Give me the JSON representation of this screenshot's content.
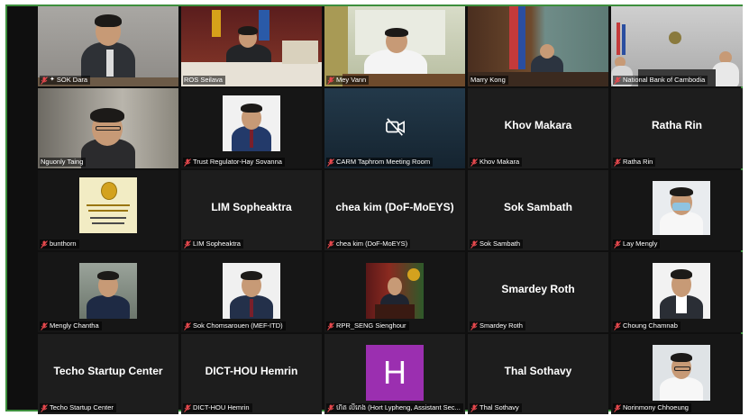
{
  "participants": [
    {
      "name": "SOK Dara",
      "pinned": true
    },
    {
      "name": "ROS Seilava"
    },
    {
      "name": "Mey Vann"
    },
    {
      "name": "Marry Kong",
      "active": true
    },
    {
      "name": "National Bank of Cambodia"
    },
    {
      "name": "Nguonly Taing"
    },
    {
      "name": "Trust Regulator-Hay Sovanna"
    },
    {
      "name": "CARM Taphrom Meeting Room"
    },
    {
      "name": "Khov Makara",
      "display": "Khov Makara"
    },
    {
      "name": "Ratha Rin",
      "display": "Ratha Rin"
    },
    {
      "name": "bunthorn"
    },
    {
      "name": "LIM Sopheaktra",
      "display": "LIM Sopheaktra"
    },
    {
      "name": "chea kim (DoF-MoEYS)",
      "display": "chea kim (DoF-MoEYS)"
    },
    {
      "name": "Sok Sambath",
      "display": "Sok Sambath"
    },
    {
      "name": "Lay Mengly"
    },
    {
      "name": "Mengly Chantha"
    },
    {
      "name": "Sok Chomsarouen (MEF-ITD)"
    },
    {
      "name": "RPR_SENG Sienghour"
    },
    {
      "name": "Smardey Roth",
      "display": "Smardey Roth"
    },
    {
      "name": "Choung Chamnab"
    },
    {
      "name": "Techo Startup Center",
      "display": "Techo Startup Center"
    },
    {
      "name": "DICT-HOU Hemrin",
      "display": "DICT-HOU Hemrin"
    },
    {
      "name": "ហ៊ត លីភេង (Hort Lypheng, Assistant Sec...",
      "avatar_letter": "H"
    },
    {
      "name": "Thal Sothavy",
      "display": "Thal Sothavy"
    },
    {
      "name": "Norinmony Chhoeung"
    }
  ],
  "colors": {
    "frame_border": "#3d8f3d",
    "active_border": "#c9d94a",
    "muted_icon": "#e5484d",
    "avatar_purple": "#9b2fb0"
  },
  "icons": {
    "muted": "mic-muted-icon",
    "video_off": "video-off-icon",
    "pin": "pin-icon"
  }
}
